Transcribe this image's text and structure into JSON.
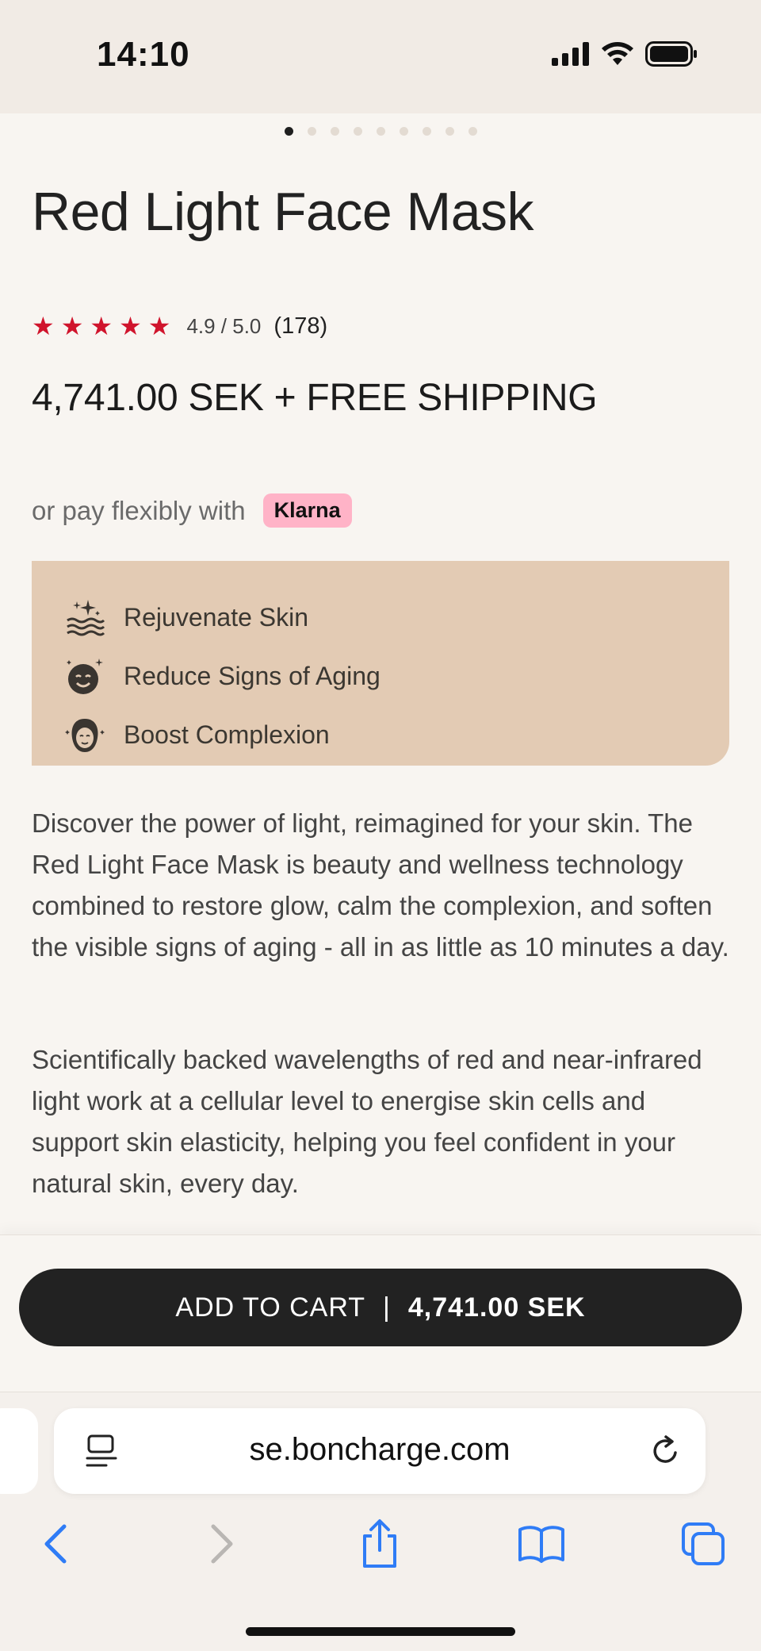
{
  "status_bar": {
    "time": "14:10"
  },
  "carousel": {
    "count": 9,
    "active_index": 0
  },
  "product": {
    "title": "Red Light Face Mask",
    "rating": {
      "stars": 5,
      "value": "4.9 / 5.0",
      "count": "(178)"
    },
    "price": "4,741.00 SEK + FREE SHIPPING",
    "pay_text": "or pay flexibly with",
    "pay_provider": "Klarna"
  },
  "benefits": [
    {
      "icon": "sparkle-skin-icon",
      "label": "Rejuvenate Skin"
    },
    {
      "icon": "smiling-face-icon",
      "label": "Reduce Signs of Aging"
    },
    {
      "icon": "face-mask-icon",
      "label": "Boost Complexion"
    }
  ],
  "description": [
    "Discover the power of light, reimagined for your skin. The Red Light Face Mask is beauty and wellness technology combined to restore glow, calm the complexion, and soften the visible signs of aging - all in as little as 10 minutes a day.",
    "Scientifically backed wavelengths of red and near-infrared light work at a cellular level to energise skin cells and support skin elasticity, helping you feel confident in your natural skin, every day."
  ],
  "cart": {
    "label": "ADD TO CART",
    "separator": "|",
    "price": "4,741.00 SEK"
  },
  "browser": {
    "url": "se.boncharge.com",
    "toolbar": [
      "back-icon",
      "forward-icon",
      "share-icon",
      "bookmarks-icon",
      "tabs-icon"
    ]
  },
  "colors": {
    "background": "#f8f5f1",
    "star": "#d0142c",
    "benefits_bg": "#e3cbb4",
    "cart_button": "#222222",
    "klarna": "#ffb3c7",
    "ios_blue": "#2f7cf6"
  }
}
